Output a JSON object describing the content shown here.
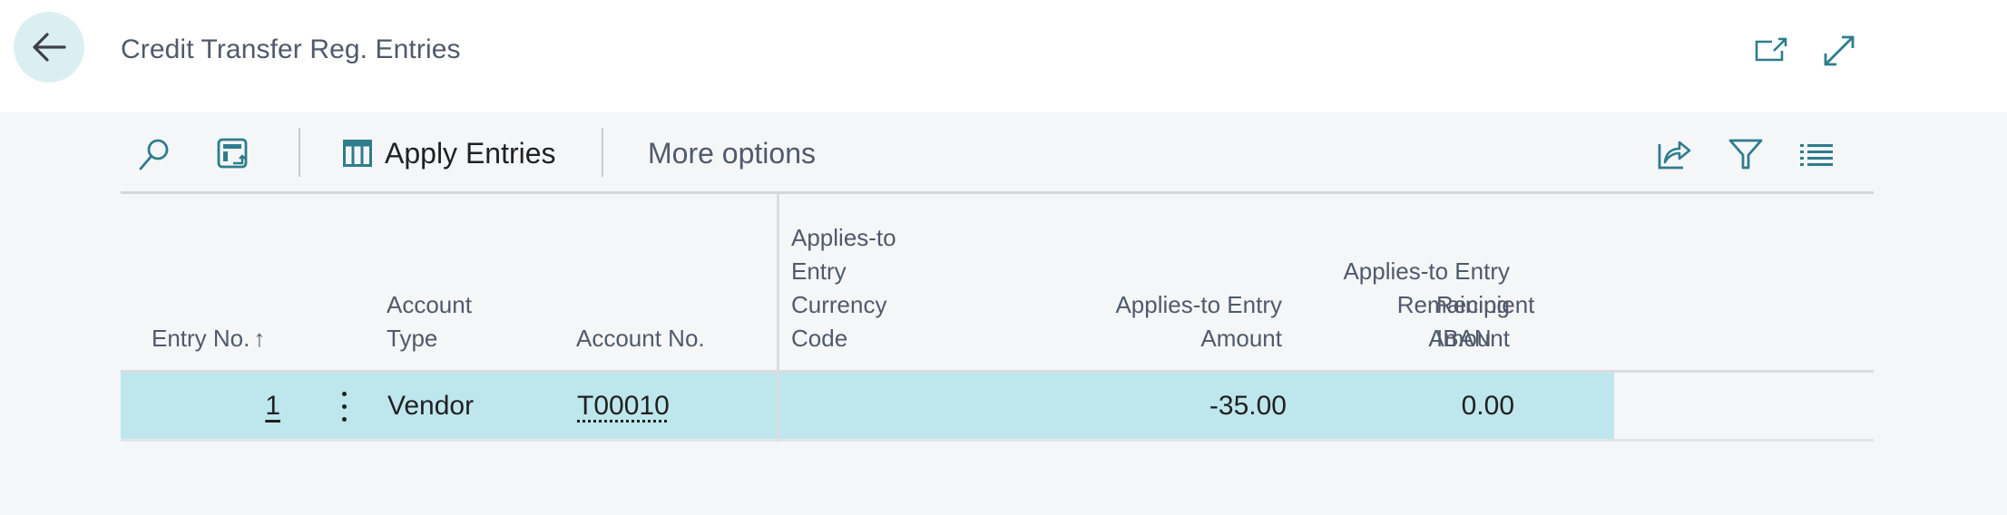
{
  "header": {
    "title": "Credit Transfer Reg. Entries",
    "back_icon": "arrow-left-icon",
    "actions": [
      {
        "name": "open-in-new-window",
        "icon": "open-in-new-window-icon"
      },
      {
        "name": "expand",
        "icon": "expand-diagonal-icon"
      }
    ]
  },
  "toolbar": {
    "search_icon": "search-icon",
    "layout_icon": "personalize-layout-icon",
    "apply_entries_label": "Apply Entries",
    "apply_entries_icon": "columns-icon",
    "more_options_label": "More options",
    "right_icons": [
      "share-icon",
      "filter-icon",
      "list-view-icon"
    ]
  },
  "table": {
    "columns": [
      {
        "key": "entry_no",
        "label": "Entry No.",
        "sort": "ascending",
        "sort_glyph": "↑"
      },
      {
        "key": "account_type",
        "label_lines": [
          "Account",
          "Type"
        ]
      },
      {
        "key": "account_no",
        "label": "Account No."
      },
      {
        "key": "currency_code",
        "label_lines": [
          "Applies-to",
          "Entry",
          "Currency",
          "Code"
        ]
      },
      {
        "key": "amount",
        "label_lines": [
          "Applies-to Entry",
          "Amount"
        ]
      },
      {
        "key": "remaining_amount",
        "label_lines": [
          "Applies-to Entry",
          "Remaining",
          "Amount"
        ]
      },
      {
        "key": "recipient_iban",
        "label_lines": [
          "Recipient",
          "IBAN"
        ]
      }
    ],
    "rows": [
      {
        "entry_no": "1",
        "account_type": "Vendor",
        "account_no": "T00010",
        "currency_code": "",
        "amount": "-35.00",
        "remaining_amount": "0.00",
        "recipient_iban": "",
        "selected": true
      }
    ]
  },
  "colors": {
    "accent": "#2e7d8c",
    "selected_row": "#bee7ed",
    "back_button_bg": "#dbeff3",
    "page_bg": "#f5f6f8"
  }
}
